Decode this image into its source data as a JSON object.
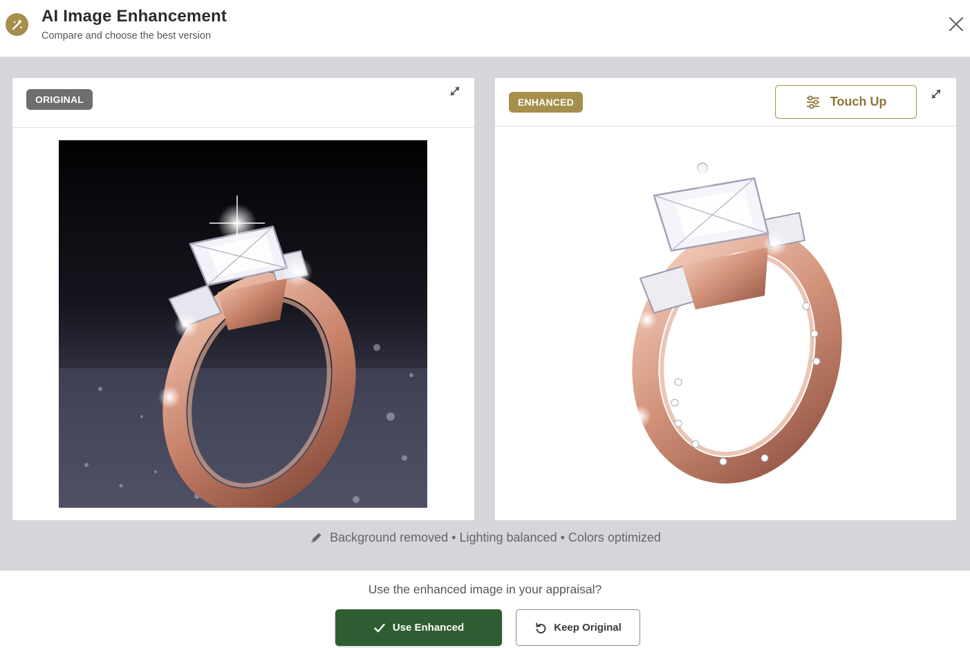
{
  "header": {
    "title": "AI Image Enhancement",
    "subtitle": "Compare and choose the best version",
    "icon": "magic-wand-icon",
    "close_icon": "close-icon"
  },
  "original": {
    "badge": "ORIGINAL",
    "expand_icon": "expand-icon",
    "image_description_icon": "ring-photo-dark-background"
  },
  "enhanced": {
    "badge": "ENHANCED",
    "touch_up_label": "Touch Up",
    "touch_up_icon": "sliders-icon",
    "expand_icon": "expand-icon",
    "image_description_icon": "ring-photo-white-background"
  },
  "summary": {
    "icon": "pencil-icon",
    "text": "Background removed • Lighting balanced • Colors optimized"
  },
  "footer": {
    "question": "Use the enhanced image in your appraisal?",
    "use_enhanced_label": "Use Enhanced",
    "use_enhanced_icon": "check-icon",
    "keep_original_label": "Keep Original",
    "keep_original_icon": "undo-icon"
  },
  "colors": {
    "accent_gold": "#a68f4d",
    "primary_green": "#2f5d33",
    "original_badge": "#6e6e6e",
    "compare_background": "#d5d5da"
  }
}
